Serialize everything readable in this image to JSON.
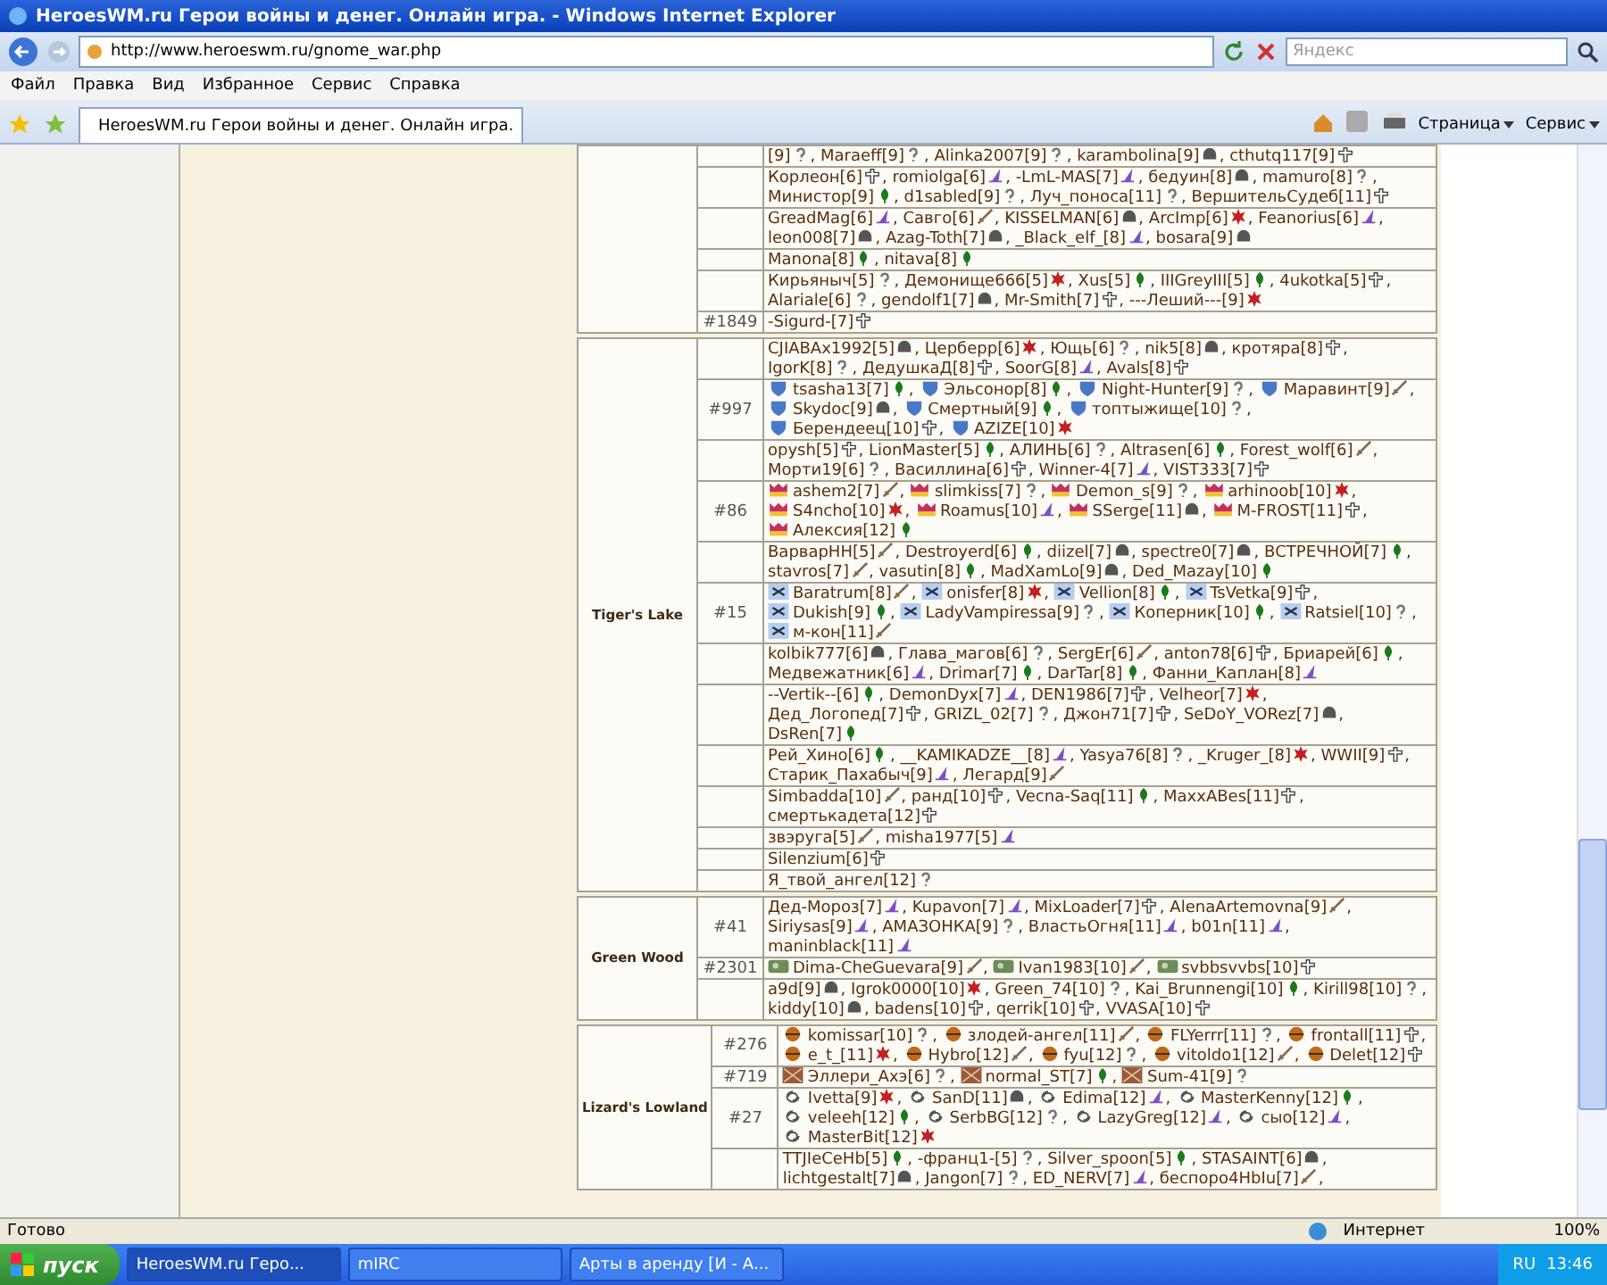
{
  "window": {
    "title": "HeroesWM.ru Герои войны и денег. Онлайн игра. - Windows Internet Explorer"
  },
  "address_bar": {
    "url": "http://www.heroeswm.ru/gnome_war.php"
  },
  "search": {
    "placeholder": "Яндекс"
  },
  "menu": [
    "Файл",
    "Правка",
    "Вид",
    "Избранное",
    "Сервис",
    "Справка"
  ],
  "tab": {
    "label": "HeroesWM.ru Герои войны и денег. Онлайн игра.",
    "selected": true
  },
  "toolbar": [
    "Страница",
    "Сервис"
  ],
  "locations": [
    {
      "rows": [
        {
          "clan": "",
          "kind": "plain",
          "players": [
            {
              "name": "[9]",
              "kind": "unknown",
              "sep": ","
            },
            {
              "name": "Maraeff[9]",
              "kind": "unknown",
              "sep": ","
            },
            {
              "name": "Alinka2007[9]",
              "kind": "unknown",
              "sep": ","
            },
            {
              "name": "karambolina[9]",
              "kind": "helmet",
              "sep": ","
            },
            {
              "name": "cthutq117[9]",
              "kind": "cross"
            }
          ]
        },
        {
          "clan": "",
          "kind": "plain",
          "players": [
            {
              "name": "Корлеон[6]",
              "kind": "cross",
              "sep": ","
            },
            {
              "name": "romiolga[6]",
              "kind": "hat",
              "sep": ","
            },
            {
              "name": "-LmL-MAS[7]",
              "kind": "hat",
              "sep": ","
            },
            {
              "name": "бедуин[8]",
              "kind": "helmet",
              "sep": ","
            },
            {
              "name": "mamuro[8]",
              "kind": "unknown",
              "sep": ","
            },
            {
              "name": "Министор[9]",
              "kind": "leaf",
              "sep": ","
            },
            {
              "name": "d1sabled[9]",
              "kind": "unknown",
              "sep": ","
            },
            {
              "name": "Луч_поноса[11]",
              "kind": "unknown",
              "sep": ","
            },
            {
              "name": "ВершительСудеб[11]",
              "kind": "cross"
            }
          ]
        },
        {
          "clan": "",
          "kind": "plain",
          "players": [
            {
              "name": "GreadMag[6]",
              "kind": "hat",
              "sep": ","
            },
            {
              "name": "Савго[6]",
              "kind": "sword",
              "sep": ","
            },
            {
              "name": "KISSELMAN[6]",
              "kind": "helmet",
              "sep": ","
            },
            {
              "name": "ArcImp[6]",
              "kind": "star",
              "sep": ","
            },
            {
              "name": "Feanorius[6]",
              "kind": "hat",
              "sep": ","
            },
            {
              "name": "leon008[7]",
              "kind": "helmet",
              "sep": ","
            },
            {
              "name": "Azag-Toth[7]",
              "kind": "helmet",
              "sep": ","
            },
            {
              "name": "_Black_elf_[8]",
              "kind": "hat",
              "sep": ","
            },
            {
              "name": "bosara[9]",
              "kind": "helmet"
            }
          ]
        },
        {
          "clan": "",
          "kind": "plain",
          "players": [
            {
              "name": "Manona[8]",
              "kind": "leaf",
              "sep": ","
            },
            {
              "name": "nitava[8]",
              "kind": "leaf"
            }
          ]
        },
        {
          "clan": "",
          "kind": "plain",
          "players": [
            {
              "name": "Кирьяныч[5]",
              "kind": "unknown",
              "sep": ","
            },
            {
              "name": "Демонище666[5]",
              "kind": "star",
              "sep": ","
            },
            {
              "name": "Xus[5]",
              "kind": "leaf",
              "sep": ","
            },
            {
              "name": "IIIGreyIII[5]",
              "kind": "leaf",
              "sep": ","
            },
            {
              "name": "4ukotka[5]",
              "kind": "cross",
              "sep": ","
            },
            {
              "name": "Alariale[6]",
              "kind": "unknown",
              "sep": ","
            },
            {
              "name": "gendolf1[7]",
              "kind": "helmet",
              "sep": ","
            },
            {
              "name": "Mr-Smith[7]",
              "kind": "cross",
              "sep": ","
            },
            {
              "name": "---Леший---[9]",
              "kind": "star"
            }
          ]
        },
        {
          "clan": "#1849",
          "kind": "plain",
          "players": [
            {
              "name": "-Sigurd-[7]",
              "kind": "cross"
            }
          ]
        }
      ]
    },
    {
      "name": "Tiger's Lake",
      "rows": [
        {
          "clan": "",
          "kind": "plain",
          "players": [
            {
              "name": "CJIABAx1992[5]",
              "kind": "helmet",
              "sep": ","
            },
            {
              "name": "Церберр[6]",
              "kind": "star",
              "sep": ","
            },
            {
              "name": "Ющь[6]",
              "kind": "unknown",
              "sep": ","
            },
            {
              "name": "nik5[8]",
              "kind": "helmet",
              "sep": ","
            },
            {
              "name": "кротяра[8]",
              "kind": "cross",
              "sep": ","
            },
            {
              "name": "IgorK[8]",
              "kind": "unknown",
              "sep": ","
            },
            {
              "name": "ДедушкаД[8]",
              "kind": "cross",
              "sep": ","
            },
            {
              "name": "SoorG[8]",
              "kind": "hat",
              "sep": ","
            },
            {
              "name": "Avals[8]",
              "kind": "cross"
            }
          ]
        },
        {
          "clan": "#997",
          "kind": "shield",
          "players": [
            {
              "name": "tsasha13[7]",
              "kind": "leaf",
              "sep": ","
            },
            {
              "name": "Эльсонор[8]",
              "kind": "leaf",
              "sep": ","
            },
            {
              "name": "Night-Hunter[9]",
              "kind": "unknown",
              "sep": ","
            },
            {
              "name": "Маравинт[9]",
              "kind": "sword",
              "sep": ","
            },
            {
              "name": "Skydoc[9]",
              "kind": "helmet",
              "sep": ","
            },
            {
              "name": "Смертный[9]",
              "kind": "leaf",
              "sep": ","
            },
            {
              "name": "топтыжище[10]",
              "kind": "unknown",
              "sep": ","
            },
            {
              "name": "Берендеец[10]",
              "kind": "cross",
              "sep": ","
            },
            {
              "name": "AZIZE[10]",
              "kind": "star"
            }
          ]
        },
        {
          "clan": "",
          "kind": "plain",
          "players": [
            {
              "name": "opysh[5]",
              "kind": "cross",
              "sep": ","
            },
            {
              "name": "LionMaster[5]",
              "kind": "leaf",
              "sep": ","
            },
            {
              "name": "АЛИНЬ[6]",
              "kind": "unknown",
              "sep": ","
            },
            {
              "name": "Altrasen[6]",
              "kind": "leaf",
              "sep": ","
            },
            {
              "name": "Forest_wolf[6]",
              "kind": "sword",
              "sep": ","
            },
            {
              "name": "Морти19[6]",
              "kind": "unknown",
              "sep": ","
            },
            {
              "name": "Василлина[6]",
              "kind": "cross",
              "sep": ","
            },
            {
              "name": "Winner-4[7]",
              "kind": "hat",
              "sep": ","
            },
            {
              "name": "VIST333[7]",
              "kind": "cross"
            }
          ]
        },
        {
          "clan": "#86",
          "kind": "crown",
          "players": [
            {
              "name": "ashem2[7]",
              "kind": "sword",
              "sep": ","
            },
            {
              "name": "slimkiss[7]",
              "kind": "unknown",
              "sep": ","
            },
            {
              "name": "Demon_s[9]",
              "kind": "unknown",
              "sep": ","
            },
            {
              "name": "arhinoob[10]",
              "kind": "star",
              "sep": ","
            },
            {
              "name": "S4ncho[10]",
              "kind": "star",
              "sep": ","
            },
            {
              "name": "Roamus[10]",
              "kind": "hat",
              "sep": ","
            },
            {
              "name": "SSerge[11]",
              "kind": "helmet",
              "sep": ","
            },
            {
              "name": "M-FROST[11]",
              "kind": "cross",
              "sep": ","
            },
            {
              "name": "Алексия[12]",
              "kind": "leaf"
            }
          ]
        },
        {
          "clan": "",
          "kind": "plain",
          "players": [
            {
              "name": "ВарварНН[5]",
              "kind": "sword",
              "sep": ","
            },
            {
              "name": "Destroyerd[6]",
              "kind": "leaf",
              "sep": ","
            },
            {
              "name": "diizel[7]",
              "kind": "helmet",
              "sep": ","
            },
            {
              "name": "spectre0[7]",
              "kind": "helmet",
              "sep": ","
            },
            {
              "name": "ВСТРЕЧНОЙ[7]",
              "kind": "leaf",
              "sep": ","
            },
            {
              "name": "stavros[7]",
              "kind": "sword",
              "sep": ","
            },
            {
              "name": "vasutin[8]",
              "kind": "leaf",
              "sep": ","
            },
            {
              "name": "MadXamLo[9]",
              "kind": "helmet",
              "sep": ","
            },
            {
              "name": "Ded_Mazay[10]",
              "kind": "leaf"
            }
          ]
        },
        {
          "clan": "#15",
          "kind": "blades",
          "players": [
            {
              "name": "Baratrum[8]",
              "kind": "sword",
              "sep": ","
            },
            {
              "name": "onisfer[8]",
              "kind": "star",
              "sep": ","
            },
            {
              "name": "Vellion[8]",
              "kind": "leaf",
              "sep": ","
            },
            {
              "name": "TsVetka[9]",
              "kind": "cross",
              "sep": ","
            },
            {
              "name": "Dukish[9]",
              "kind": "leaf",
              "sep": ","
            },
            {
              "name": "LadyVampiressa[9]",
              "kind": "unknown",
              "sep": ","
            },
            {
              "name": "Коперник[10]",
              "kind": "leaf",
              "sep": ","
            },
            {
              "name": "Ratsiel[10]",
              "kind": "unknown",
              "sep": ","
            },
            {
              "name": "м-кон[11]",
              "kind": "sword"
            }
          ]
        },
        {
          "clan": "",
          "kind": "plain",
          "players": [
            {
              "name": "kolbik777[6]",
              "kind": "helmet",
              "sep": ","
            },
            {
              "name": "Глава_магов[6]",
              "kind": "unknown",
              "sep": ","
            },
            {
              "name": "SergEr[6]",
              "kind": "sword",
              "sep": ","
            },
            {
              "name": "anton78[6]",
              "kind": "cross",
              "sep": ","
            },
            {
              "name": "Бриарей[6]",
              "kind": "leaf",
              "sep": ","
            },
            {
              "name": "Медвежатник[6]",
              "kind": "hat",
              "sep": ","
            },
            {
              "name": "Drimar[7]",
              "kind": "leaf",
              "sep": ","
            },
            {
              "name": "DarTar[8]",
              "kind": "leaf",
              "sep": ","
            },
            {
              "name": "Фанни_Каплан[8]",
              "kind": "hat"
            }
          ]
        },
        {
          "clan": "",
          "kind": "plain",
          "players": [
            {
              "name": "--Vertik--[6]",
              "kind": "leaf",
              "sep": ","
            },
            {
              "name": "DemonDyx[7]",
              "kind": "hat",
              "sep": ","
            },
            {
              "name": "DEN1986[7]",
              "kind": "cross",
              "sep": ","
            },
            {
              "name": "Velheor[7]",
              "kind": "star",
              "sep": ","
            },
            {
              "name": "Дед_Логопед[7]",
              "kind": "cross",
              "sep": ","
            },
            {
              "name": "GRIZL_02[7]",
              "kind": "unknown",
              "sep": ","
            },
            {
              "name": "Джон71[7]",
              "kind": "cross",
              "sep": ","
            },
            {
              "name": "SeDoY_VORez[7]",
              "kind": "helmet",
              "sep": ","
            },
            {
              "name": "DsRen[7]",
              "kind": "leaf"
            }
          ]
        },
        {
          "clan": "",
          "kind": "plain",
          "players": [
            {
              "name": "Рей_Хино[6]",
              "kind": "leaf",
              "sep": ","
            },
            {
              "name": "__KAMIKADZE__[8]",
              "kind": "hat",
              "sep": ","
            },
            {
              "name": "Yasya76[8]",
              "kind": "unknown",
              "sep": ","
            },
            {
              "name": "_Kruger_[8]",
              "kind": "star",
              "sep": ","
            },
            {
              "name": "WWII[9]",
              "kind": "cross",
              "sep": ","
            },
            {
              "name": "Старик_Пахабыч[9]",
              "kind": "hat",
              "sep": ","
            },
            {
              "name": "Легард[9]",
              "kind": "sword"
            }
          ]
        },
        {
          "clan": "",
          "kind": "plain",
          "players": [
            {
              "name": "Simbadda[10]",
              "kind": "sword",
              "sep": ","
            },
            {
              "name": "ранд[10]",
              "kind": "cross",
              "sep": ","
            },
            {
              "name": "Vecna-Saq[11]",
              "kind": "leaf",
              "sep": ","
            },
            {
              "name": "MaxxABes[11]",
              "kind": "cross",
              "sep": ","
            },
            {
              "name": "смертькадета[12]",
              "kind": "cross"
            }
          ]
        },
        {
          "clan": "",
          "kind": "plain",
          "players": [
            {
              "name": "звэруга[5]",
              "kind": "sword",
              "sep": ","
            },
            {
              "name": "misha1977[5]",
              "kind": "hat"
            }
          ]
        },
        {
          "clan": "",
          "kind": "plain",
          "players": [
            {
              "name": "Silenzium[6]",
              "kind": "cross"
            }
          ]
        },
        {
          "clan": "",
          "kind": "plain",
          "players": [
            {
              "name": "Я_твой_ангел[12]",
              "kind": "unknown"
            }
          ]
        }
      ]
    },
    {
      "name": "Green Wood",
      "rows": [
        {
          "clan": "#41",
          "kind": "plain",
          "players": [
            {
              "name": "Дед-Мороз[7]",
              "kind": "hat",
              "sep": ","
            },
            {
              "name": "Kupavon[7]",
              "kind": "hat",
              "sep": ","
            },
            {
              "name": "MixLoader[7]",
              "kind": "cross",
              "sep": ","
            },
            {
              "name": "AlenaArtemovna[9]",
              "kind": "sword",
              "sep": ","
            },
            {
              "name": "Siriysas[9]",
              "kind": "hat",
              "sep": ","
            },
            {
              "name": "АМАЗОНКА[9]",
              "kind": "unknown",
              "sep": ","
            },
            {
              "name": "ВластьОгня[11]",
              "kind": "hat",
              "sep": ","
            },
            {
              "name": "b01n[11]",
              "kind": "hat",
              "sep": ","
            },
            {
              "name": "maninblack[11]",
              "kind": "hat"
            }
          ]
        },
        {
          "clan": "#2301",
          "kind": "camo",
          "players": [
            {
              "name": "Dima-CheGuevara[9]",
              "kind": "sword",
              "sep": ","
            },
            {
              "name": "Ivan1983[10]",
              "kind": "sword",
              "sep": ","
            },
            {
              "name": "svbbsvvbs[10]",
              "kind": "cross"
            }
          ]
        },
        {
          "clan": "",
          "kind": "plain",
          "players": [
            {
              "name": "a9d[9]",
              "kind": "helmet",
              "sep": ","
            },
            {
              "name": "Igrok0000[10]",
              "kind": "star",
              "sep": ","
            },
            {
              "name": "Green_74[10]",
              "kind": "unknown",
              "sep": ","
            },
            {
              "name": "Kai_Brunnengi[10]",
              "kind": "leaf",
              "sep": ","
            },
            {
              "name": "Kirill98[10]",
              "kind": "unknown",
              "sep": ","
            },
            {
              "name": "kiddy[10]",
              "kind": "helmet",
              "sep": ","
            },
            {
              "name": "badens[10]",
              "kind": "cross",
              "sep": ","
            },
            {
              "name": "qerrik[10]",
              "kind": "cross",
              "sep": ","
            },
            {
              "name": "VVASA[10]",
              "kind": "cross"
            }
          ]
        }
      ]
    },
    {
      "name": "Lizard's Lowland",
      "rows": [
        {
          "clan": "#276",
          "kind": "orb",
          "players": [
            {
              "name": "komissar[10]",
              "kind": "unknown",
              "sep": ","
            },
            {
              "name": "злодей-ангел[11]",
              "kind": "sword",
              "sep": ","
            },
            {
              "name": "FLYerrr[11]",
              "kind": "unknown",
              "sep": ","
            },
            {
              "name": "frontall[11]",
              "kind": "cross",
              "sep": ","
            },
            {
              "name": "e_t_[11]",
              "kind": "star",
              "sep": ","
            },
            {
              "name": "Hybro[12]",
              "kind": "sword",
              "sep": ","
            },
            {
              "name": "fyu[12]",
              "kind": "unknown",
              "sep": ","
            },
            {
              "name": "vitoldo1[12]",
              "kind": "sword",
              "sep": ","
            },
            {
              "name": "Delet[12]",
              "kind": "cross"
            }
          ]
        },
        {
          "clan": "#719",
          "kind": "box",
          "players": [
            {
              "name": "Эллери_Ахэ[6]",
              "kind": "unknown",
              "sep": ","
            },
            {
              "name": "normal_ST[7]",
              "kind": "leaf",
              "sep": ","
            },
            {
              "name": "Sum-41[9]",
              "kind": "unknown"
            }
          ]
        },
        {
          "clan": "#27",
          "kind": "swirl",
          "players": [
            {
              "name": "Ivetta[9]",
              "kind": "star",
              "sep": ","
            },
            {
              "name": "SanD[11]",
              "kind": "helmet",
              "sep": ","
            },
            {
              "name": "Edima[12]",
              "kind": "hat",
              "sep": ","
            },
            {
              "name": "MasterKenny[12]",
              "kind": "leaf",
              "sep": ","
            },
            {
              "name": "veleeh[12]",
              "kind": "leaf",
              "sep": ","
            },
            {
              "name": "SerbBG[12]",
              "kind": "unknown",
              "sep": ","
            },
            {
              "name": "LazyGreg[12]",
              "kind": "hat",
              "sep": ","
            },
            {
              "name": "сыо[12]",
              "kind": "hat",
              "sep": ","
            },
            {
              "name": "MasterBit[12]",
              "kind": "star"
            }
          ]
        },
        {
          "clan": "",
          "kind": "plain",
          "players": [
            {
              "name": "TTJIeCeHb[5]",
              "kind": "leaf",
              "sep": ","
            },
            {
              "name": "-франц1-[5]",
              "kind": "unknown",
              "sep": ","
            },
            {
              "name": "Silver_spoon[5]",
              "kind": "leaf",
              "sep": ","
            },
            {
              "name": "STASAINT[6]",
              "kind": "helmet",
              "sep": ","
            },
            {
              "name": "lichtgestalt[7]",
              "kind": "helmet",
              "sep": ","
            },
            {
              "name": "Jangon[7]",
              "kind": "unknown",
              "sep": ","
            },
            {
              "name": "ED_NERV[7]",
              "kind": "hat",
              "sep": ","
            },
            {
              "name": "беспоро4HbIu[7]",
              "kind": "sword",
              "sep": ","
            }
          ]
        }
      ]
    }
  ],
  "status_bar": {
    "text": "Готово",
    "zone": "Интернет",
    "zoom": "100%"
  },
  "taskbar": {
    "start": "пуск",
    "tasks": [
      {
        "label": "HeroesWM.ru Геро...",
        "selected": true
      },
      {
        "label": "mIRC",
        "selected": false
      },
      {
        "label": "Арты в аренду [И - А...",
        "selected": false
      }
    ],
    "language": "RU",
    "clock": "13:46"
  }
}
